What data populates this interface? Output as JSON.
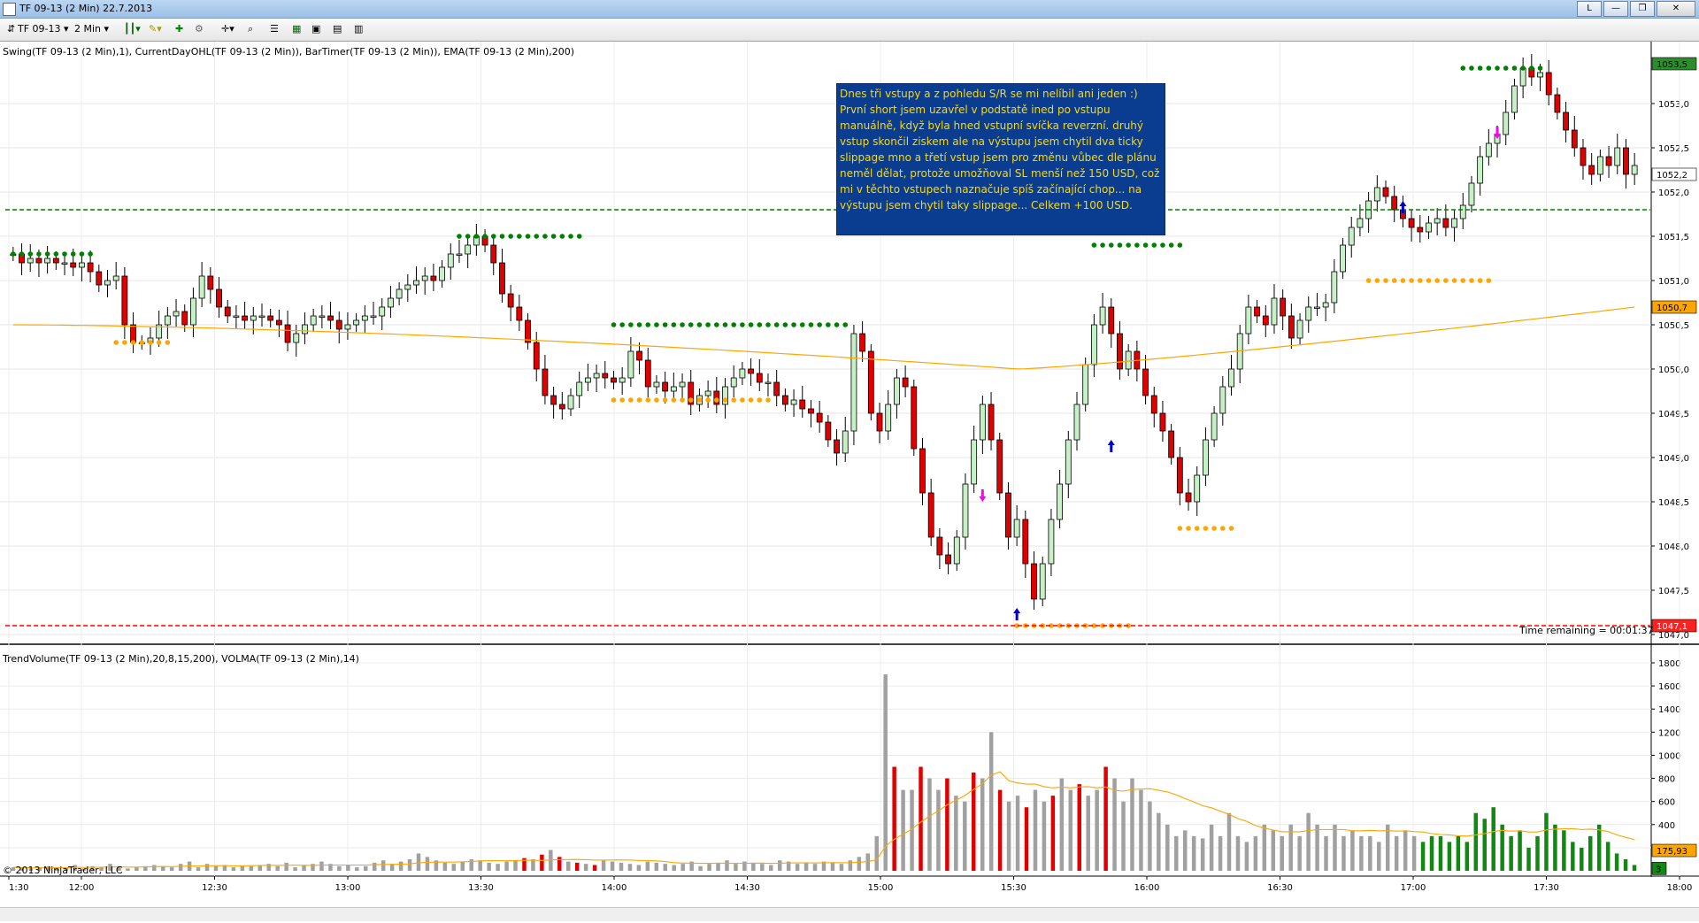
{
  "window": {
    "title": "TF 09-13 (2 Min)  22.7.2013",
    "buttons": [
      "L",
      "—",
      "❐",
      "✕"
    ]
  },
  "toolbar": {
    "instrument": "TF 09-13",
    "interval": "2 Min"
  },
  "price_panel": {
    "indicators_label": "Swing(TF 09-13 (2 Min),1), CurrentDayOHL(TF 09-13 (2 Min)), BarTimer(TF 09-13 (2 Min)), EMA(TF 09-13 (2 Min),200)",
    "y_ticks": [
      "1053,0",
      "1052,5",
      "1052,0",
      "1051,5",
      "1051,0",
      "1050,5",
      "1050,0",
      "1049,5",
      "1049,0",
      "1048,5",
      "1048,0",
      "1047,5",
      "1047,0"
    ],
    "price_tags": {
      "high": "1053,5",
      "last": "1052,2",
      "ema": "1050,7",
      "low": "1047,1"
    },
    "time_remaining": "Time remaining = 00:01:37",
    "colors": {
      "up": "#c6f0c6",
      "down": "#e00000",
      "swing_high": "#008000",
      "swing_low": "#ffa500",
      "ema": "#ffa500",
      "day_low": "#ff0000"
    }
  },
  "annotation": {
    "text": "Dnes tři vstupy a z pohledu S/R se mi nelíbil ani jeden :) První short jsem uzavřel v podstatě ined po vstupu manuálně, když byla hned vstupní svíčka reverzní. druhý vstup skončil ziskem ale na výstupu jsem chytil dva ticky slippage mno a třetí vstup jsem pro změnu vůbec dle plánu neměl dělat, protože umožňoval SL menší než 150 USD, což mi v těchto vstupech naznačuje spíš začínající chop... na výstupu jsem chytil taky slippage... Celkem +100 USD."
  },
  "volume_panel": {
    "indicators_label": "TrendVolume(TF 09-13 (2 Min),20,8,15,200), VOLMA(TF 09-13 (2 Min),14)",
    "y_ticks": [
      "1800",
      "1600",
      "1400",
      "1200",
      "1000",
      "800",
      "600",
      "400",
      "200"
    ],
    "volma_tag": "175,93",
    "count_tag": "3",
    "copyright": "© 2013 NinjaTrader, LLC"
  },
  "x_axis": {
    "ticks": [
      "1:30",
      "12:00",
      "12:30",
      "13:00",
      "13:30",
      "14:00",
      "14:30",
      "15:00",
      "15:30",
      "16:00",
      "16:30",
      "17:00",
      "17:30",
      "18:00"
    ]
  },
  "chart_data": {
    "type": "candlestick",
    "instrument": "TF 09-13",
    "interval": "2 Min",
    "date": "22.7.2013",
    "ohlc_start": 1051.3,
    "closes": [
      1051.3,
      1051.2,
      1051.25,
      1051.2,
      1051.25,
      1051.2,
      1051.2,
      1051.15,
      1051.2,
      1051.1,
      1050.95,
      1051.0,
      1051.05,
      1050.5,
      1050.3,
      1050.3,
      1050.35,
      1050.5,
      1050.6,
      1050.65,
      1050.5,
      1050.8,
      1051.05,
      1050.9,
      1050.7,
      1050.6,
      1050.6,
      1050.55,
      1050.6,
      1050.6,
      1050.55,
      1050.5,
      1050.3,
      1050.4,
      1050.5,
      1050.6,
      1050.6,
      1050.55,
      1050.45,
      1050.5,
      1050.55,
      1050.6,
      1050.6,
      1050.7,
      1050.8,
      1050.9,
      1050.95,
      1051.0,
      1051.05,
      1051.0,
      1051.15,
      1051.3,
      1051.3,
      1051.4,
      1051.5,
      1051.4,
      1051.2,
      1050.85,
      1050.7,
      1050.55,
      1050.3,
      1050.0,
      1049.7,
      1049.6,
      1049.55,
      1049.7,
      1049.85,
      1049.9,
      1049.95,
      1049.9,
      1049.85,
      1049.9,
      1050.2,
      1050.1,
      1049.8,
      1049.85,
      1049.75,
      1049.8,
      1049.85,
      1049.6,
      1049.7,
      1049.75,
      1049.6,
      1049.8,
      1049.9,
      1050.0,
      1049.95,
      1049.85,
      1049.85,
      1049.7,
      1049.6,
      1049.65,
      1049.55,
      1049.5,
      1049.4,
      1049.2,
      1049.05,
      1049.3,
      1050.4,
      1050.2,
      1049.5,
      1049.3,
      1049.6,
      1049.9,
      1049.8,
      1049.1,
      1048.6,
      1048.1,
      1047.9,
      1047.8,
      1048.1,
      1048.7,
      1049.2,
      1049.6,
      1049.2,
      1048.6,
      1048.1,
      1048.3,
      1047.8,
      1047.4,
      1047.8,
      1048.3,
      1048.7,
      1049.2,
      1049.6,
      1050.05,
      1050.5,
      1050.7,
      1050.4,
      1050.0,
      1050.2,
      1050.0,
      1049.7,
      1049.5,
      1049.3,
      1049.0,
      1048.6,
      1048.5,
      1048.8,
      1049.2,
      1049.5,
      1049.8,
      1050.0,
      1050.4,
      1050.7,
      1050.6,
      1050.5,
      1050.8,
      1050.6,
      1050.35,
      1050.55,
      1050.7,
      1050.7,
      1050.75,
      1051.1,
      1051.4,
      1051.6,
      1051.7,
      1051.9,
      1052.05,
      1051.95,
      1051.8,
      1051.7,
      1051.6,
      1051.55,
      1051.65,
      1051.7,
      1051.6,
      1051.7,
      1051.85,
      1052.1,
      1052.4,
      1052.55,
      1052.65,
      1052.9,
      1053.2,
      1053.4,
      1053.3,
      1053.35,
      1053.1,
      1052.9,
      1052.7,
      1052.5,
      1052.3,
      1052.2,
      1052.4,
      1052.3,
      1052.5,
      1052.2,
      1052.3
    ],
    "ema_200": {
      "start": 1050.5,
      "min": 1050.0,
      "end": 1050.7
    },
    "swing_high_levels": [
      1051.3,
      1051.5,
      1050.5,
      1051.4,
      1053.4
    ],
    "swing_low_levels": [
      1050.3,
      1049.65,
      1047.1,
      1048.2,
      1051.0
    ],
    "day_high": 1051.8,
    "day_low": 1047.1,
    "volume": [
      30,
      25,
      20,
      30,
      40,
      20,
      30,
      50,
      20,
      40,
      30,
      60,
      40,
      20,
      30,
      40,
      50,
      40,
      30,
      60,
      80,
      30,
      60,
      40,
      50,
      30,
      40,
      40,
      50,
      60,
      40,
      70,
      30,
      50,
      60,
      80,
      60,
      40,
      50,
      30,
      40,
      70,
      90,
      60,
      80,
      100,
      150,
      120,
      90,
      70,
      60,
      80,
      100,
      90,
      70,
      60,
      80,
      90,
      110,
      100,
      140,
      180,
      120,
      80,
      70,
      60,
      50,
      90,
      80,
      70,
      60,
      50,
      80,
      70,
      60,
      50,
      60,
      80,
      40,
      60,
      70,
      90,
      60,
      80,
      70,
      60,
      50,
      90,
      80,
      60,
      70,
      60,
      80,
      70,
      60,
      90,
      120,
      150,
      300,
      1700,
      900,
      700,
      700,
      900,
      800,
      700,
      800,
      650,
      600,
      850,
      800,
      1200,
      700,
      600,
      650,
      550,
      700,
      600,
      650,
      800,
      700,
      750,
      650,
      700,
      900,
      800,
      600,
      800,
      700,
      600,
      500,
      400,
      300,
      350,
      300,
      280,
      400,
      300,
      500,
      300,
      250,
      300,
      400,
      350,
      300,
      400,
      300,
      500,
      400,
      300,
      400,
      300,
      350,
      300,
      300,
      250,
      400,
      300,
      350,
      300,
      250,
      300,
      300,
      250,
      300,
      250,
      500,
      450,
      550,
      400,
      300,
      350,
      200,
      300,
      500,
      400,
      350,
      250,
      200,
      300,
      400,
      250,
      150,
      100,
      50
    ],
    "volume_colors": [
      "gray",
      "red",
      "green"
    ],
    "y_range": [
      1047.0,
      1053.6
    ],
    "volume_range": [
      0,
      1800
    ]
  }
}
